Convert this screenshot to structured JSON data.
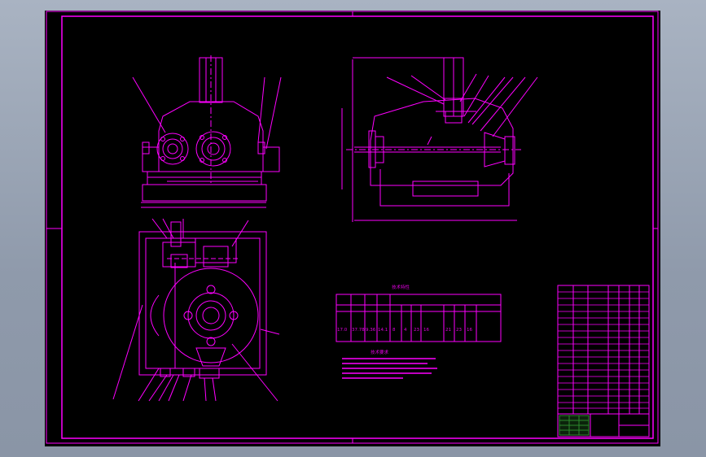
{
  "colors": {
    "background": "#8f9aab",
    "canvas": "#000000",
    "line": "#ff00ff",
    "text": "#e000e0",
    "table_highlight": "#2c8a2c"
  },
  "params_table": {
    "title": "技术特性",
    "row_values": [
      "17.0",
      "37.78",
      "9.36",
      "14.1",
      "8",
      "4",
      "23",
      "16",
      "21",
      "23",
      "16"
    ]
  },
  "tech_requirements": {
    "title": "技术要求"
  }
}
